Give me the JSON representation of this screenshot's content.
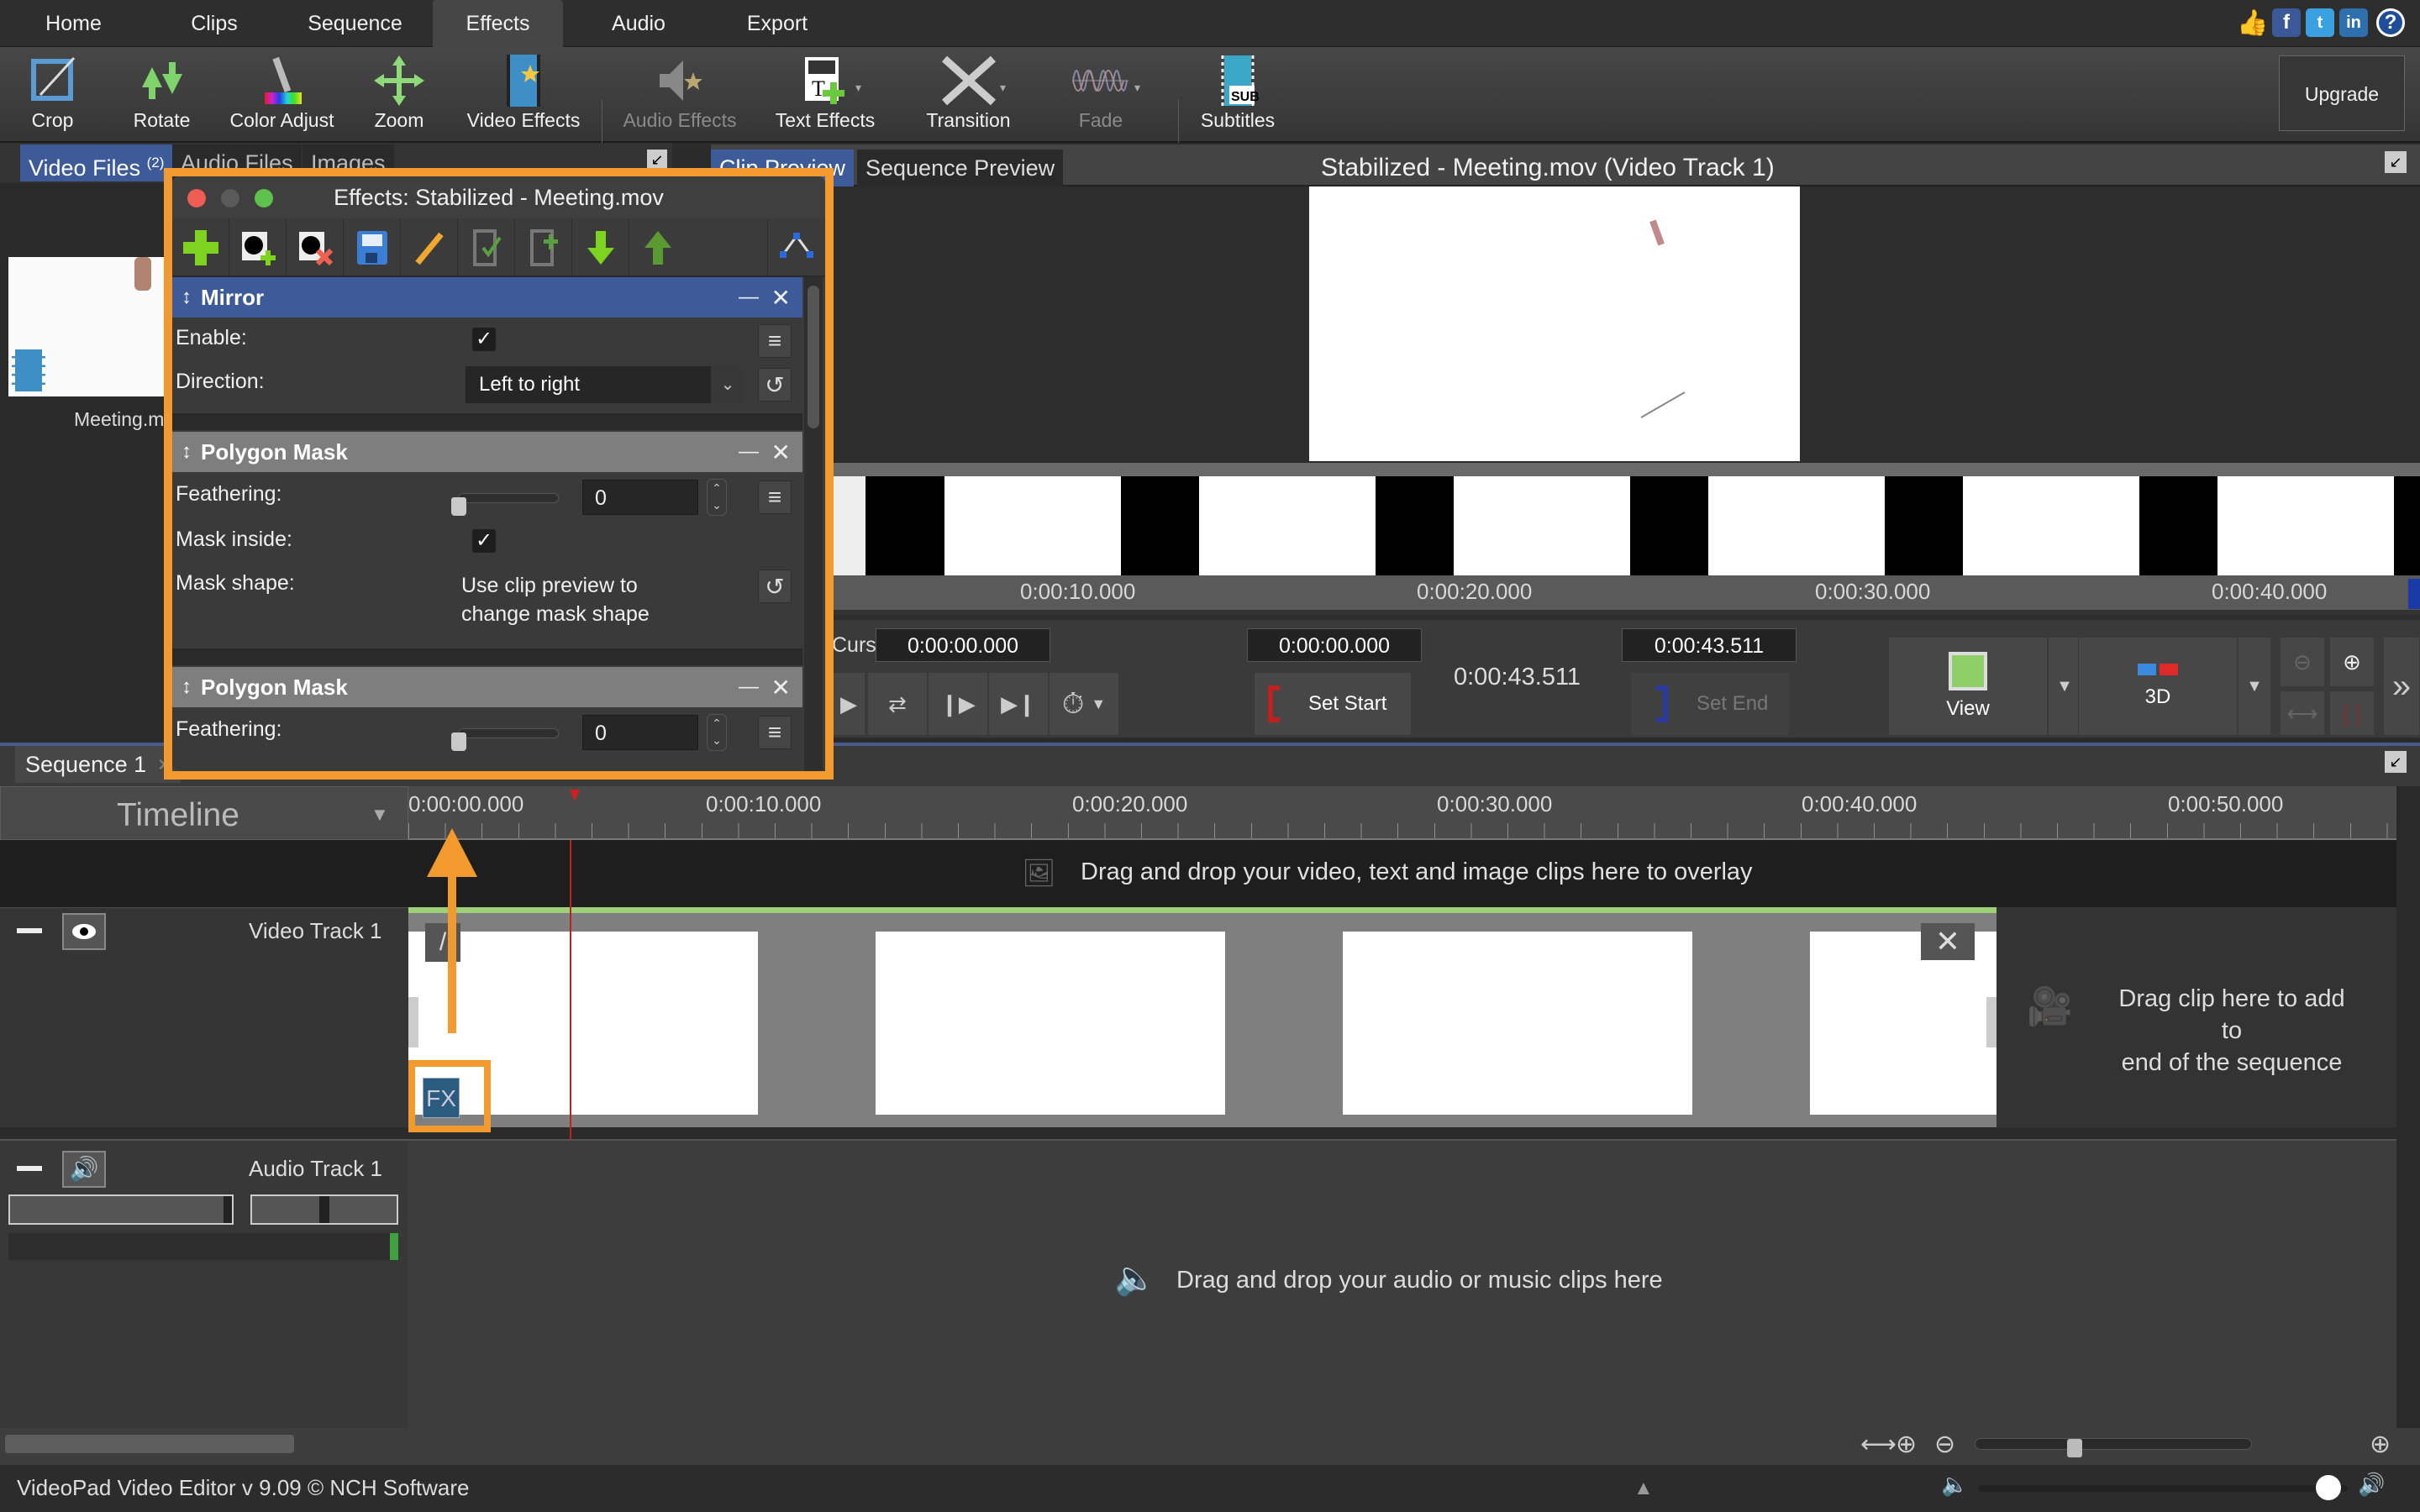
{
  "app": {
    "status_text": "VideoPad Video Editor v 9.09 © NCH Software"
  },
  "menu": {
    "tabs": [
      {
        "label": "Home"
      },
      {
        "label": "Clips"
      },
      {
        "label": "Sequence"
      },
      {
        "label": "Effects",
        "active": true
      },
      {
        "label": "Audio"
      },
      {
        "label": "Export"
      }
    ],
    "social": [
      "like-icon",
      "facebook-icon",
      "twitter-icon",
      "linkedin-icon",
      "help-icon"
    ]
  },
  "toolbar": {
    "tools": [
      {
        "label": "Crop",
        "icon": "crop-icon"
      },
      {
        "label": "Rotate",
        "icon": "rotate-icon"
      },
      {
        "label": "Color Adjust",
        "icon": "color-adjust-icon"
      },
      {
        "label": "Zoom",
        "icon": "zoom-icon"
      },
      {
        "label": "Video Effects",
        "icon": "video-effects-icon"
      },
      {
        "label": "Audio Effects",
        "icon": "audio-effects-icon",
        "disabled": true
      },
      {
        "label": "Text Effects",
        "icon": "text-effects-icon"
      },
      {
        "label": "Transition",
        "icon": "transition-icon"
      },
      {
        "label": "Fade",
        "icon": "fade-icon",
        "disabled": true
      },
      {
        "label": "Subtitles",
        "icon": "subtitles-icon"
      }
    ],
    "upgrade_label": "Upgrade",
    "subtitles_badge": "SUB"
  },
  "media_bin": {
    "tabs": [
      {
        "label": "Video Files",
        "count": "(2)",
        "active": true
      },
      {
        "label": "Audio Files"
      },
      {
        "label": "Images"
      }
    ],
    "items": [
      {
        "name": "Meeting.mov"
      }
    ]
  },
  "preview": {
    "tabs": [
      {
        "label": "Clip Preview",
        "active": true
      },
      {
        "label": "Sequence Preview"
      }
    ],
    "title": "Stabilized - Meeting.mov (Video Track 1)",
    "ruler_ticks": [
      "0:00:10.000",
      "0:00:20.000",
      "0:00:30.000",
      "0:00:40.000"
    ],
    "cursor_label": "Cursor:",
    "cursor_value": "0:00:00.000",
    "start_value": "0:00:00.000",
    "duration_value": "0:00:43.511",
    "end_value": "0:00:43.511",
    "set_start_label": "Set Start",
    "set_end_label": "Set End",
    "view_label": "View",
    "threed_label": "3D"
  },
  "effects_dialog": {
    "title": "Effects: Stabilized - Meeting.mov",
    "tools": [
      "add-effect-icon",
      "add-mask-icon",
      "remove-mask-icon",
      "save-icon",
      "edit-icon",
      "apply-to-clip-icon",
      "add-to-clip-icon",
      "move-down-icon",
      "move-up-icon"
    ],
    "effects": [
      {
        "name": "Mirror",
        "selected": true,
        "enable_label": "Enable:",
        "enable": true,
        "direction_label": "Direction:",
        "direction": "Left to right"
      },
      {
        "name": "Polygon Mask",
        "feathering_label": "Feathering:",
        "feathering": "0",
        "mask_inside_label": "Mask inside:",
        "mask_inside": true,
        "mask_shape_label": "Mask shape:",
        "mask_shape_hint_1": "Use clip preview to",
        "mask_shape_hint_2": "change mask shape"
      },
      {
        "name": "Polygon Mask",
        "feathering_label": "Feathering:",
        "feathering": "0"
      }
    ],
    "feathering_fraction": 0
  },
  "timeline": {
    "sequence_tab": "Sequence 1",
    "mode_label": "Timeline",
    "ruler_ticks": [
      "0:00:00.000",
      "0:00:10.000",
      "0:00:20.000",
      "0:00:30.000",
      "0:00:40.000",
      "0:00:50.000"
    ],
    "overlay_hint": "Drag and drop your video, text and image clips here to overlay",
    "video_track_label": "Video Track 1",
    "end_hint_1": "Drag clip here to add to",
    "end_hint_2": "end of the sequence",
    "fx_badge": "FX",
    "audio_track_label": "Audio Track 1",
    "audio_hint": "Drag and drop your audio or music clips here",
    "zoom_fraction": 0.35,
    "master_volume_fraction": 0.98
  },
  "colors": {
    "accent_orange": "#f39a2e",
    "selected_blue": "#3d5a99",
    "clip_green": "#9fd07a"
  }
}
